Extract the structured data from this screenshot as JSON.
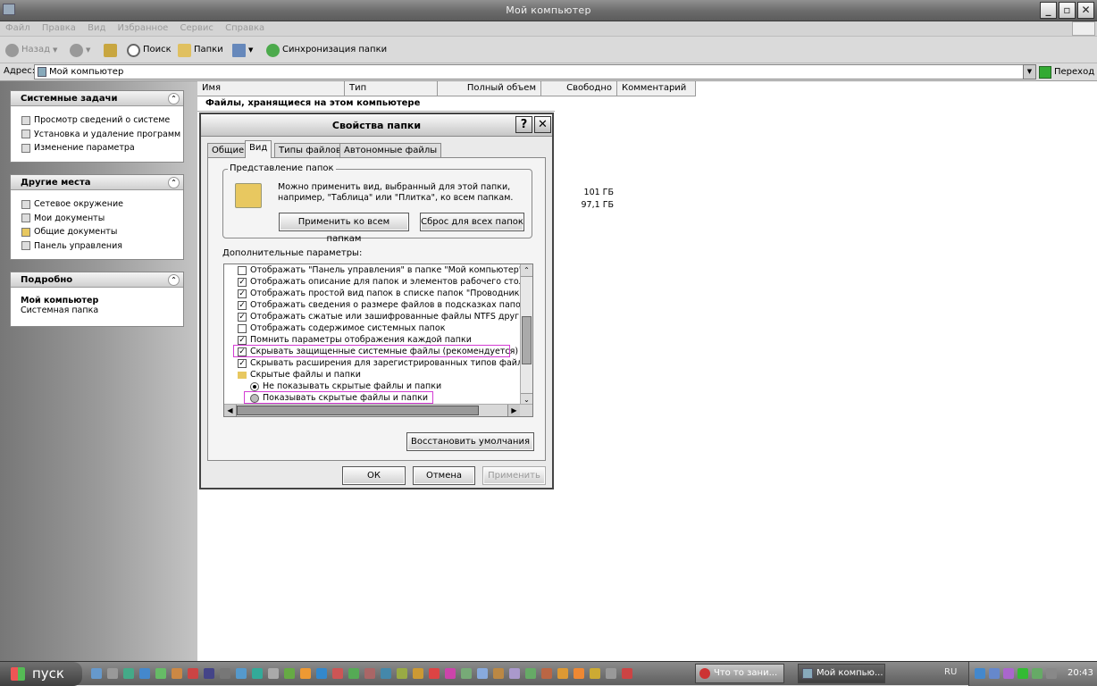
{
  "window": {
    "title": "Мой компьютер"
  },
  "menu": [
    "Файл",
    "Правка",
    "Вид",
    "Избранное",
    "Сервис",
    "Справка"
  ],
  "toolbar": {
    "back": "Назад",
    "search": "Поиск",
    "folders": "Папки",
    "sync": "Синхронизация папки"
  },
  "address": {
    "label": "Адрес:",
    "value": "Мой компьютер",
    "go": "Переход"
  },
  "sidebar": {
    "system_tasks": {
      "title": "Системные задачи",
      "items": [
        "Просмотр сведений о системе",
        "Установка и удаление программ",
        "Изменение параметра"
      ]
    },
    "other_places": {
      "title": "Другие места",
      "items": [
        "Сетевое окружение",
        "Мои документы",
        "Общие документы",
        "Панель управления"
      ]
    },
    "details": {
      "title": "Подробно",
      "name": "Мой компьютер",
      "type": "Системная папка"
    }
  },
  "columns": [
    "Имя",
    "Тип",
    "Полный объем",
    "Свободно",
    "Комментарий"
  ],
  "group_header": "Файлы, хранящиеся на этом компьютере",
  "sizes": [
    "101 ГБ",
    "97,1 ГБ"
  ],
  "dialog": {
    "title": "Свойства папки",
    "help": "?",
    "tabs": [
      "Общие",
      "Вид",
      "Типы файлов",
      "Автономные файлы"
    ],
    "active_tab": "Вид",
    "group_title": "Представление папок",
    "group_text_1": "Можно применить вид, выбранный для этой папки,",
    "group_text_2": "например, \"Таблица\" или \"Плитка\", ко всем папкам.",
    "apply_all": "Применить ко всем папкам",
    "reset_all": "Сброс для всех папок",
    "advanced_label": "Дополнительные параметры:",
    "options": [
      {
        "kind": "check",
        "checked": false,
        "label": "Отображать \"Панель управления\" в папке \"Мой компьютер\""
      },
      {
        "kind": "check",
        "checked": true,
        "label": "Отображать описание для папок и элементов рабочего стола"
      },
      {
        "kind": "check",
        "checked": true,
        "label": "Отображать простой вид папок в списке папок \"Проводника\""
      },
      {
        "kind": "check",
        "checked": true,
        "label": "Отображать сведения о размере файлов в подсказках папок"
      },
      {
        "kind": "check",
        "checked": true,
        "label": "Отображать сжатые или зашифрованные файлы NTFS другим"
      },
      {
        "kind": "check",
        "checked": false,
        "label": "Отображать содержимое системных папок"
      },
      {
        "kind": "check",
        "checked": true,
        "label": "Помнить параметры отображения каждой папки"
      },
      {
        "kind": "check",
        "checked": true,
        "label": "Скрывать защищенные системные файлы (рекомендуется)"
      },
      {
        "kind": "check",
        "checked": true,
        "label": "Скрывать расширения для зарегистрированных типов файлов"
      },
      {
        "kind": "folder",
        "label": "Скрытые файлы и папки"
      },
      {
        "kind": "radio",
        "checked": true,
        "label": "Не показывать скрытые файлы и папки"
      },
      {
        "kind": "radio",
        "checked": false,
        "label": "Показывать скрытые файлы и папки"
      }
    ],
    "restore_defaults": "Восстановить умолчания",
    "ok": "ОК",
    "cancel": "Отмена",
    "apply": "Применить"
  },
  "taskbar": {
    "start": "пуск",
    "tasks": [
      "Что то зани...",
      "Мой компью..."
    ],
    "lang": "RU",
    "clock": "20:43"
  }
}
